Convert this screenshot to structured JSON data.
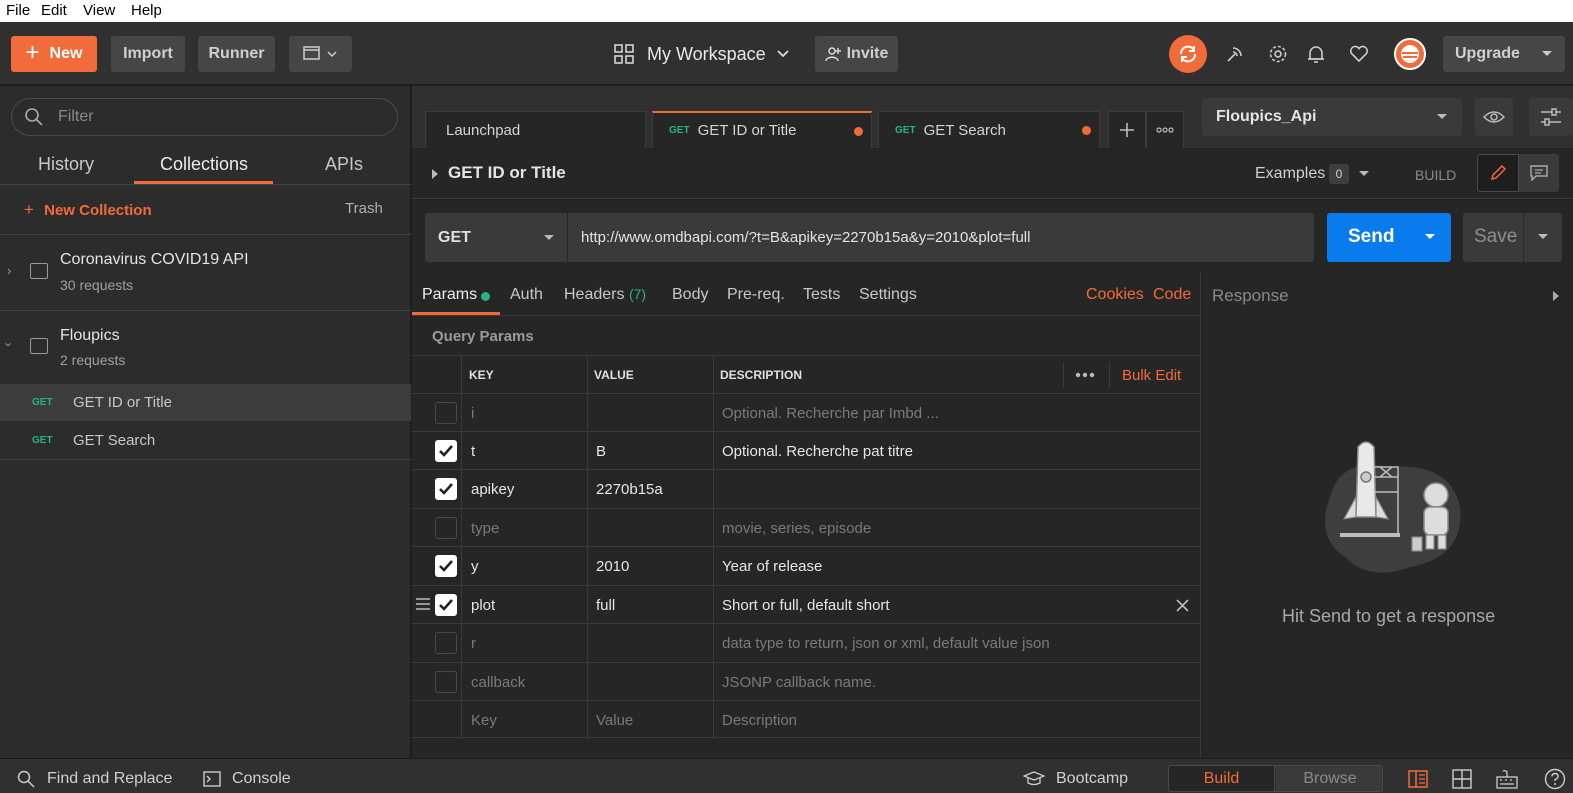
{
  "menubar": {
    "file": "File",
    "edit": "Edit",
    "view": "View",
    "help": "Help"
  },
  "header": {
    "new_label": "New",
    "import_label": "Import",
    "runner_label": "Runner",
    "workspace_label": "My Workspace",
    "invite_label": "Invite",
    "upgrade_label": "Upgrade",
    "accent_color": "#f26b3a"
  },
  "sidebar": {
    "filter_placeholder": "Filter",
    "tabs": {
      "history": "History",
      "collections": "Collections",
      "apis": "APIs"
    },
    "new_collection": "New Collection",
    "trash": "Trash",
    "collections": [
      {
        "title": "Coronavirus COVID19 API",
        "subtitle": "30 requests"
      },
      {
        "title": "Floupics",
        "subtitle": "2 requests"
      }
    ],
    "requests": [
      {
        "method": "GET",
        "name": "GET ID or Title"
      },
      {
        "method": "GET",
        "name": "GET Search"
      }
    ]
  },
  "tabs": [
    {
      "label": "Launchpad"
    },
    {
      "method": "GET",
      "label": "GET ID or Title"
    },
    {
      "method": "GET",
      "label": "GET Search"
    }
  ],
  "environment": {
    "selected": "Floupics_Api"
  },
  "request": {
    "name": "GET ID or Title",
    "examples_label": "Examples",
    "examples_count": "0",
    "build_label": "BUILD",
    "method": "GET",
    "url": "http://www.omdbapi.com/?t=B&apikey=2270b15a&y=2010&plot=full",
    "send_label": "Send",
    "save_label": "Save"
  },
  "param_tabs": {
    "params": "Params",
    "auth": "Auth",
    "headers": "Headers",
    "headers_count": "(7)",
    "body": "Body",
    "prereq": "Pre-req.",
    "tests": "Tests",
    "settings": "Settings",
    "cookies": "Cookies",
    "code": "Code"
  },
  "query_params": {
    "label": "Query Params",
    "columns": {
      "key": "KEY",
      "value": "VALUE",
      "description": "DESCRIPTION"
    },
    "bulk_edit": "Bulk Edit",
    "rows": [
      {
        "checked": false,
        "key": "i",
        "value": "",
        "description": "Optional. Recherche par Imbd ..."
      },
      {
        "checked": true,
        "key": "t",
        "value": "B",
        "description": "Optional. Recherche pat titre"
      },
      {
        "checked": true,
        "key": "apikey",
        "value": "2270b15a",
        "description": ""
      },
      {
        "checked": false,
        "key": "type",
        "value": "",
        "description": "movie, series, episode"
      },
      {
        "checked": true,
        "key": "y",
        "value": "2010",
        "description": "Year of release"
      },
      {
        "checked": true,
        "key": "plot",
        "value": "full",
        "description": "Short or full, default short"
      },
      {
        "checked": false,
        "key": "r",
        "value": "",
        "description": "data type to return, json or xml, default value json"
      },
      {
        "checked": false,
        "key": "callback",
        "value": "",
        "description": "JSONP callback name."
      }
    ],
    "placeholder": {
      "key": "Key",
      "value": "Value",
      "description": "Description"
    }
  },
  "response": {
    "label": "Response",
    "empty_message": "Hit Send to get a response"
  },
  "footer": {
    "find_replace": "Find and Replace",
    "console": "Console",
    "bootcamp": "Bootcamp",
    "build": "Build",
    "browse": "Browse"
  }
}
